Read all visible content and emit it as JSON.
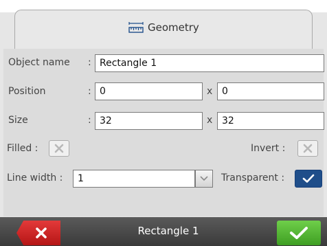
{
  "tab": {
    "icon": "ruler-icon",
    "label": "Geometry"
  },
  "form": {
    "object_name": {
      "label": "Object name",
      "value": "Rectangle 1"
    },
    "position": {
      "label": "Position",
      "x": "0",
      "separator": "x",
      "y": "0"
    },
    "size": {
      "label": "Size",
      "width": "32",
      "separator": "x",
      "height": "32"
    },
    "filled": {
      "label": "Filled :",
      "checked": false
    },
    "invert": {
      "label": "Invert :",
      "checked": false
    },
    "line_width": {
      "label": "Line width :",
      "value": "1"
    },
    "transparent": {
      "label": "Transparent :",
      "checked": true
    }
  },
  "colon": ":",
  "bottom_bar": {
    "title": "Rectangle 1",
    "cancel_icon": "close-icon",
    "ok_icon": "checkmark-icon"
  },
  "colors": {
    "accent_blue": "#1f4e8a",
    "cancel_red": "#c62828",
    "ok_green": "#4caf2f"
  }
}
